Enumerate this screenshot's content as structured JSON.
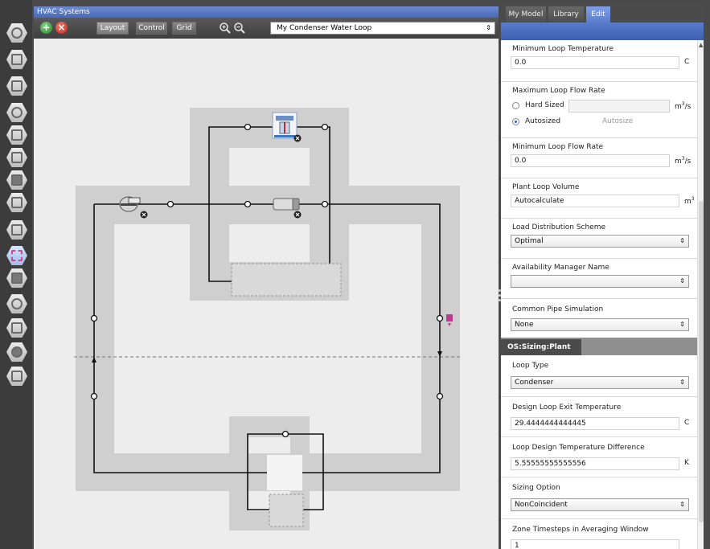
{
  "hvac": {
    "title": "HVAC Systems",
    "tabs": {
      "layout": "Layout",
      "control": "Control",
      "grid": "Grid"
    },
    "loop_select": "My Condenser Water Loop",
    "add_glyph": "+",
    "remove_glyph": "×"
  },
  "left_toolbar": {
    "icons": [
      "site-icon",
      "schedules-icon",
      "constructions-icon",
      "loads-icon",
      "space-types-icon",
      "geometry-icon",
      "facility-icon",
      "spaces-icon",
      "thermal-zones-icon",
      "hvac-systems-icon",
      "variables-icon",
      "simulation-settings-icon",
      "scripts-icon",
      "run-icon",
      "results-icon"
    ],
    "active_index": 9
  },
  "inspector": {
    "tabs": [
      "My Model",
      "Library",
      "Edit"
    ],
    "active_tab": "Edit",
    "fields": {
      "min_loop_temp": {
        "label": "Minimum Loop Temperature",
        "value": "0.0",
        "unit": "C"
      },
      "max_loop_flow": {
        "label": "Maximum Loop Flow Rate",
        "hard_sized": "Hard Sized",
        "autosized": "Autosized",
        "autosize_btn": "Autosize",
        "unit": "m",
        "unit_sup": "3",
        "unit_suffix": "/s"
      },
      "min_loop_flow": {
        "label": "Minimum Loop Flow Rate",
        "value": "0.0",
        "unit": "m",
        "unit_sup": "3",
        "unit_suffix": "/s"
      },
      "plant_volume": {
        "label": "Plant Loop Volume",
        "value": "Autocalculate",
        "unit": "m",
        "unit_sup": "3"
      },
      "load_dist": {
        "label": "Load Distribution Scheme",
        "value": "Optimal"
      },
      "avail_mgr": {
        "label": "Availability Manager Name",
        "value": ""
      },
      "common_pipe": {
        "label": "Common Pipe Simulation",
        "value": "None"
      },
      "sizing_header": "OS:Sizing:Plant",
      "loop_type": {
        "label": "Loop Type",
        "value": "Condenser"
      },
      "exit_temp": {
        "label": "Design Loop Exit Temperature",
        "value": "29.4444444444445",
        "unit": "C"
      },
      "temp_diff": {
        "label": "Loop Design Temperature Difference",
        "value": "5.55555555555556",
        "unit": "K"
      },
      "sizing_option": {
        "label": "Sizing Option",
        "value": "NonCoincident"
      },
      "zone_timesteps": {
        "label": "Zone Timesteps in Averaging Window",
        "value": "1"
      }
    },
    "select_arrows": "⇕"
  },
  "colors": {
    "canvas_bg": "#ededed",
    "loop_gray": "#cfcfcf",
    "pipe": "#111111",
    "accent_blue": "#5a7ccc",
    "setpoint_magenta": "#c0398f"
  }
}
